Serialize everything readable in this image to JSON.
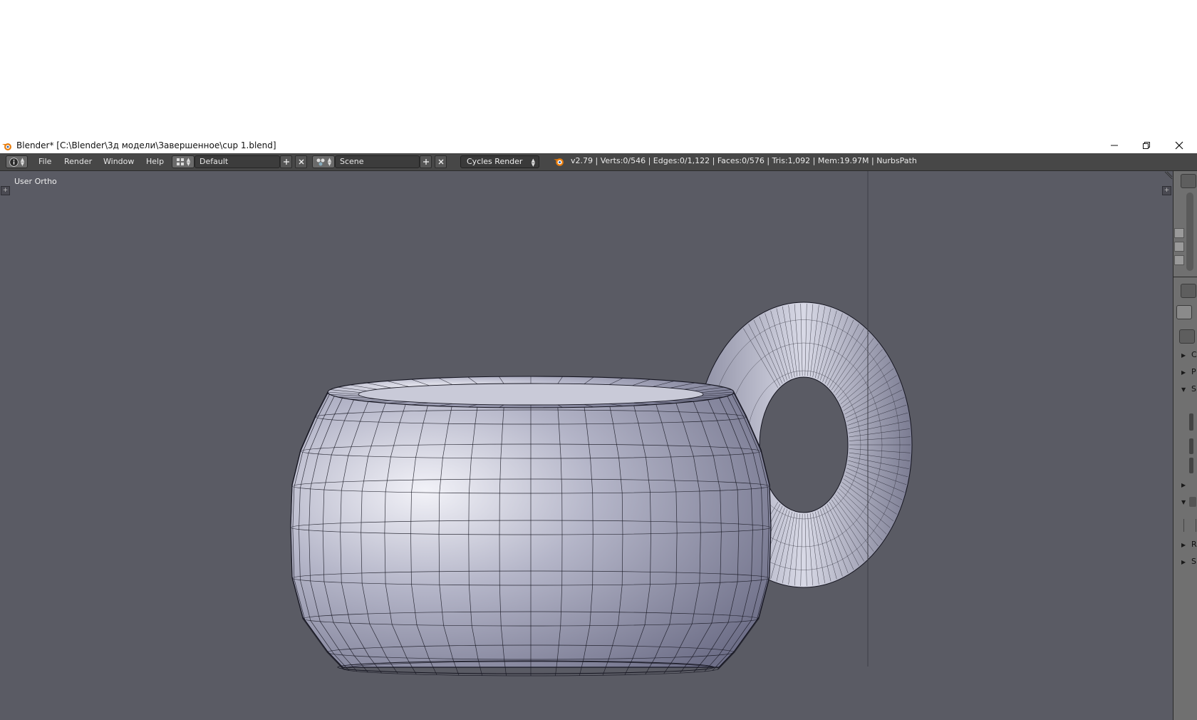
{
  "window": {
    "title": "Blender* [C:\\Blender\\3д модели\\Завершенное\\cup 1.blend]"
  },
  "menubar": {
    "menus": [
      "File",
      "Render",
      "Window",
      "Help"
    ],
    "screen_layout": "Default",
    "scene": "Scene",
    "render_engine": "Cycles Render",
    "stats": "v2.79 | Verts:0/546 | Edges:0/1,122 | Faces:0/576 | Tris:1,092 | Mem:19.97M | NurbsPath"
  },
  "viewport": {
    "view_label": "User Ortho"
  },
  "properties_panel": {
    "panel_letters": [
      "C",
      "P",
      "S",
      "R",
      "S"
    ]
  },
  "colors": {
    "viewport_bg": "#5a5b64",
    "header_bg": "#474747",
    "mesh_light": "#f2f2f8",
    "mesh_mid": "#b4b5c8",
    "mesh_dark": "#6e6f88",
    "wire": "#151520"
  }
}
